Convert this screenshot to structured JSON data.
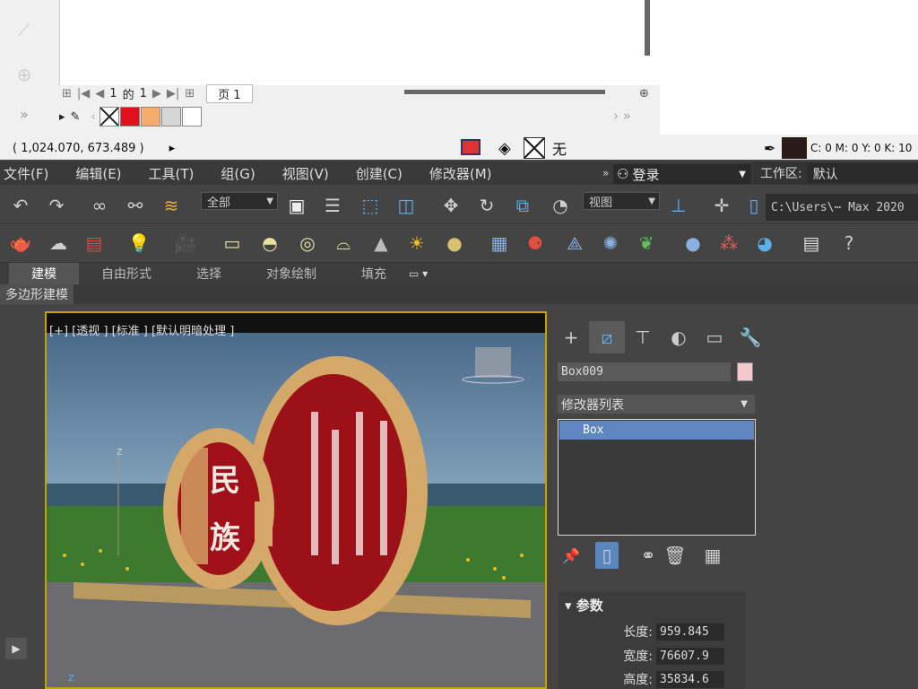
{
  "top": {
    "page_number": "1",
    "of_label": "的",
    "total_pages": "1",
    "page_label": "页 1",
    "coords": "( 1,024.070, 673.489 )",
    "no_fill_label": "无",
    "cmyk": "C: 0 M: 0 Y: 0 K: 10",
    "swatches": [
      "#ffffff",
      "#e0101c",
      "#f4ad6c",
      "#d6d6d6",
      "#ffffff"
    ]
  },
  "menu": {
    "items": [
      "文件(F)",
      "编辑(E)",
      "工具(T)",
      "组(G)",
      "视图(V)",
      "创建(C)",
      "修改器(M)"
    ],
    "login": "登录",
    "workspace_label": "工作区:",
    "workspace_value": "默认"
  },
  "toolbar": {
    "selection_filter": "全部",
    "ref_coord": "视图",
    "path": "C:\\Users\\⋯ Max 2020"
  },
  "ribbon": {
    "tabs": [
      "建模",
      "自由形式",
      "选择",
      "对象绘制",
      "填充"
    ],
    "sub": "多边形建模"
  },
  "viewport": {
    "label": "[+] [透视 ] [标准 ] [默认明暗处理 ]",
    "sign_text": "民族"
  },
  "command_panel": {
    "object_name": "Box009",
    "object_color": "#f4c8cc",
    "modifier_list": "修改器列表",
    "stack_item": "Box",
    "params_title": "参数",
    "params": [
      {
        "label": "长度:",
        "value": "959.845"
      },
      {
        "label": "宽度:",
        "value": "76607.9"
      },
      {
        "label": "高度:",
        "value": "35834.6"
      }
    ]
  }
}
